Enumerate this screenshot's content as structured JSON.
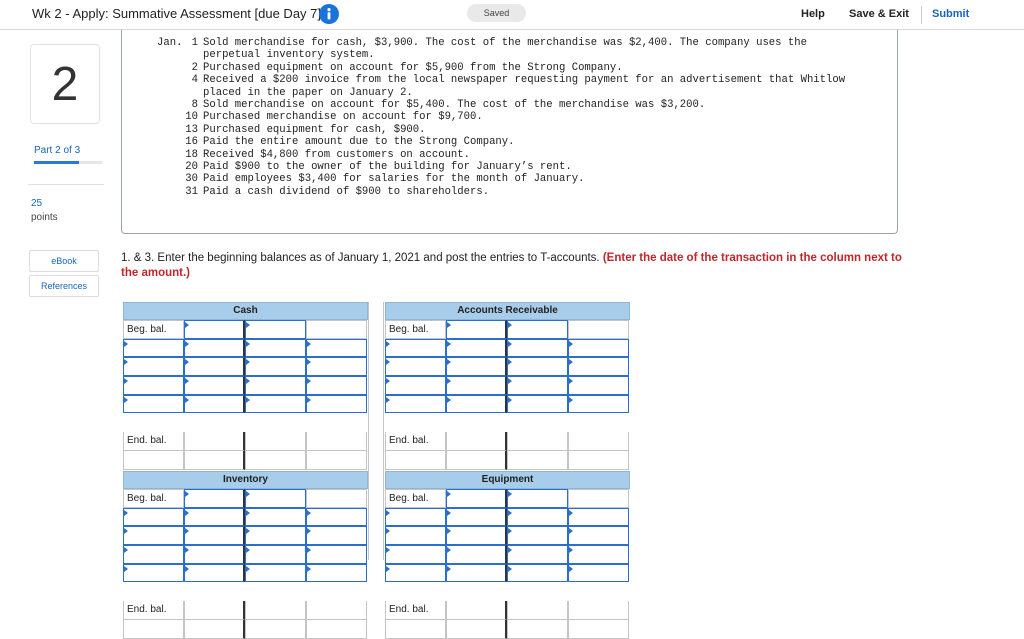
{
  "header": {
    "assignment_title": "Wk 2 - Apply: Summative Assessment [due Day 7]",
    "saved_status": "Saved",
    "help_label": "Help",
    "save_exit_label": "Save & Exit",
    "submit_label": "Submit"
  },
  "rail": {
    "question_number": "2",
    "part_label": "Part 2 of 3",
    "part_progress_fraction": 0.667,
    "points_value": "25",
    "points_label": "points",
    "ebook_label": "eBook",
    "references_label": "References"
  },
  "problem": {
    "month": "Jan.",
    "transactions": [
      {
        "day": "1",
        "text": "Sold merchandise for cash, $3,900. The cost of the merchandise was $2,400. The company uses the\nperpetual inventory system."
      },
      {
        "day": "2",
        "text": "Purchased equipment on account for $5,900 from the Strong Company."
      },
      {
        "day": "4",
        "text": "Received a $200 invoice from the local newspaper requesting payment for an advertisement that Whitlow\nplaced in the paper on January 2."
      },
      {
        "day": "8",
        "text": "Sold merchandise on account for $5,400. The cost of the merchandise was $3,200."
      },
      {
        "day": "10",
        "text": "Purchased merchandise on account for $9,700."
      },
      {
        "day": "13",
        "text": "Purchased equipment for cash, $900."
      },
      {
        "day": "16",
        "text": "Paid the entire amount due to the Strong Company."
      },
      {
        "day": "18",
        "text": "Received $4,800 from customers on account."
      },
      {
        "day": "20",
        "text": "Paid $900 to the owner of the building for January’s rent."
      },
      {
        "day": "30",
        "text": "Paid employees $3,400 for salaries for the month of January."
      },
      {
        "day": "31",
        "text": "Paid a cash dividend of $900 to shareholders."
      }
    ]
  },
  "instructions": {
    "main_text": "1. & 3. Enter the beginning balances as of January 1, 2021 and post the entries to T-accounts.",
    "emphasis_text": "(Enter the date of the transaction in the column next to the amount.)"
  },
  "t_accounts": {
    "beg_label": "Beg. bal.",
    "end_label": "End. bal.",
    "accounts": [
      {
        "title": "Cash"
      },
      {
        "title": "Accounts Receivable"
      },
      {
        "title": "Inventory"
      },
      {
        "title": "Equipment"
      }
    ]
  }
}
